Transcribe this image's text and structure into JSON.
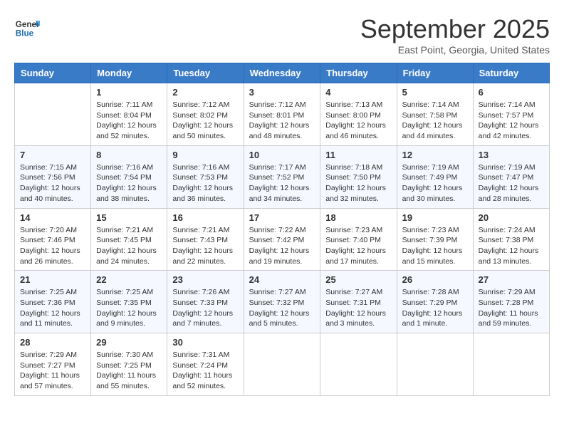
{
  "header": {
    "logo_line1": "General",
    "logo_line2": "Blue",
    "month": "September 2025",
    "location": "East Point, Georgia, United States"
  },
  "days_of_week": [
    "Sunday",
    "Monday",
    "Tuesday",
    "Wednesday",
    "Thursday",
    "Friday",
    "Saturday"
  ],
  "weeks": [
    [
      {
        "day": "",
        "info": ""
      },
      {
        "day": "1",
        "info": "Sunrise: 7:11 AM\nSunset: 8:04 PM\nDaylight: 12 hours\nand 52 minutes."
      },
      {
        "day": "2",
        "info": "Sunrise: 7:12 AM\nSunset: 8:02 PM\nDaylight: 12 hours\nand 50 minutes."
      },
      {
        "day": "3",
        "info": "Sunrise: 7:12 AM\nSunset: 8:01 PM\nDaylight: 12 hours\nand 48 minutes."
      },
      {
        "day": "4",
        "info": "Sunrise: 7:13 AM\nSunset: 8:00 PM\nDaylight: 12 hours\nand 46 minutes."
      },
      {
        "day": "5",
        "info": "Sunrise: 7:14 AM\nSunset: 7:58 PM\nDaylight: 12 hours\nand 44 minutes."
      },
      {
        "day": "6",
        "info": "Sunrise: 7:14 AM\nSunset: 7:57 PM\nDaylight: 12 hours\nand 42 minutes."
      }
    ],
    [
      {
        "day": "7",
        "info": "Sunrise: 7:15 AM\nSunset: 7:56 PM\nDaylight: 12 hours\nand 40 minutes."
      },
      {
        "day": "8",
        "info": "Sunrise: 7:16 AM\nSunset: 7:54 PM\nDaylight: 12 hours\nand 38 minutes."
      },
      {
        "day": "9",
        "info": "Sunrise: 7:16 AM\nSunset: 7:53 PM\nDaylight: 12 hours\nand 36 minutes."
      },
      {
        "day": "10",
        "info": "Sunrise: 7:17 AM\nSunset: 7:52 PM\nDaylight: 12 hours\nand 34 minutes."
      },
      {
        "day": "11",
        "info": "Sunrise: 7:18 AM\nSunset: 7:50 PM\nDaylight: 12 hours\nand 32 minutes."
      },
      {
        "day": "12",
        "info": "Sunrise: 7:19 AM\nSunset: 7:49 PM\nDaylight: 12 hours\nand 30 minutes."
      },
      {
        "day": "13",
        "info": "Sunrise: 7:19 AM\nSunset: 7:47 PM\nDaylight: 12 hours\nand 28 minutes."
      }
    ],
    [
      {
        "day": "14",
        "info": "Sunrise: 7:20 AM\nSunset: 7:46 PM\nDaylight: 12 hours\nand 26 minutes."
      },
      {
        "day": "15",
        "info": "Sunrise: 7:21 AM\nSunset: 7:45 PM\nDaylight: 12 hours\nand 24 minutes."
      },
      {
        "day": "16",
        "info": "Sunrise: 7:21 AM\nSunset: 7:43 PM\nDaylight: 12 hours\nand 22 minutes."
      },
      {
        "day": "17",
        "info": "Sunrise: 7:22 AM\nSunset: 7:42 PM\nDaylight: 12 hours\nand 19 minutes."
      },
      {
        "day": "18",
        "info": "Sunrise: 7:23 AM\nSunset: 7:40 PM\nDaylight: 12 hours\nand 17 minutes."
      },
      {
        "day": "19",
        "info": "Sunrise: 7:23 AM\nSunset: 7:39 PM\nDaylight: 12 hours\nand 15 minutes."
      },
      {
        "day": "20",
        "info": "Sunrise: 7:24 AM\nSunset: 7:38 PM\nDaylight: 12 hours\nand 13 minutes."
      }
    ],
    [
      {
        "day": "21",
        "info": "Sunrise: 7:25 AM\nSunset: 7:36 PM\nDaylight: 12 hours\nand 11 minutes."
      },
      {
        "day": "22",
        "info": "Sunrise: 7:25 AM\nSunset: 7:35 PM\nDaylight: 12 hours\nand 9 minutes."
      },
      {
        "day": "23",
        "info": "Sunrise: 7:26 AM\nSunset: 7:33 PM\nDaylight: 12 hours\nand 7 minutes."
      },
      {
        "day": "24",
        "info": "Sunrise: 7:27 AM\nSunset: 7:32 PM\nDaylight: 12 hours\nand 5 minutes."
      },
      {
        "day": "25",
        "info": "Sunrise: 7:27 AM\nSunset: 7:31 PM\nDaylight: 12 hours\nand 3 minutes."
      },
      {
        "day": "26",
        "info": "Sunrise: 7:28 AM\nSunset: 7:29 PM\nDaylight: 12 hours\nand 1 minute."
      },
      {
        "day": "27",
        "info": "Sunrise: 7:29 AM\nSunset: 7:28 PM\nDaylight: 11 hours\nand 59 minutes."
      }
    ],
    [
      {
        "day": "28",
        "info": "Sunrise: 7:29 AM\nSunset: 7:27 PM\nDaylight: 11 hours\nand 57 minutes."
      },
      {
        "day": "29",
        "info": "Sunrise: 7:30 AM\nSunset: 7:25 PM\nDaylight: 11 hours\nand 55 minutes."
      },
      {
        "day": "30",
        "info": "Sunrise: 7:31 AM\nSunset: 7:24 PM\nDaylight: 11 hours\nand 52 minutes."
      },
      {
        "day": "",
        "info": ""
      },
      {
        "day": "",
        "info": ""
      },
      {
        "day": "",
        "info": ""
      },
      {
        "day": "",
        "info": ""
      }
    ]
  ]
}
